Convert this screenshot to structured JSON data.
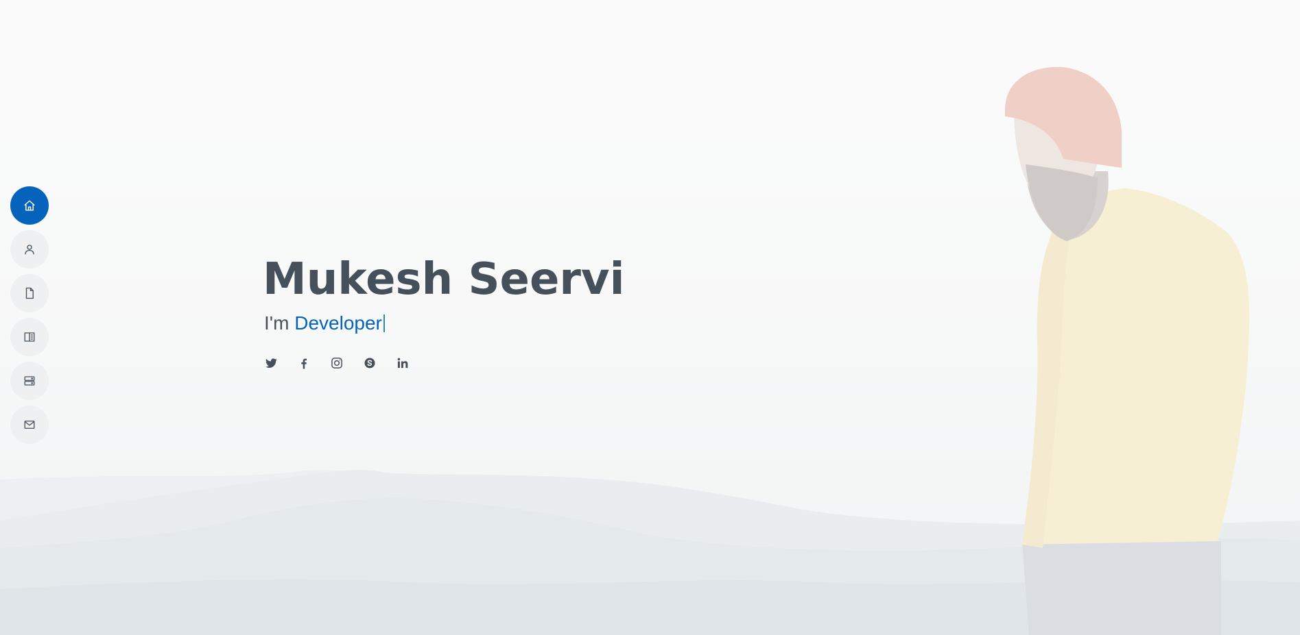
{
  "hero": {
    "name": "Mukesh Seervi",
    "prefix": "I'm",
    "typed": "Developer"
  },
  "nav": {
    "items": [
      {
        "icon": "home-icon",
        "active": true
      },
      {
        "icon": "user-icon",
        "active": false
      },
      {
        "icon": "file-icon",
        "active": false
      },
      {
        "icon": "book-icon",
        "active": false
      },
      {
        "icon": "server-icon",
        "active": false
      },
      {
        "icon": "envelope-icon",
        "active": false
      }
    ]
  },
  "social": [
    "twitter-icon",
    "facebook-icon",
    "instagram-icon",
    "skype-icon",
    "linkedin-icon"
  ],
  "colors": {
    "accent": "#0563bb",
    "text": "#45505b",
    "nav_bg": "#eef0f2"
  }
}
